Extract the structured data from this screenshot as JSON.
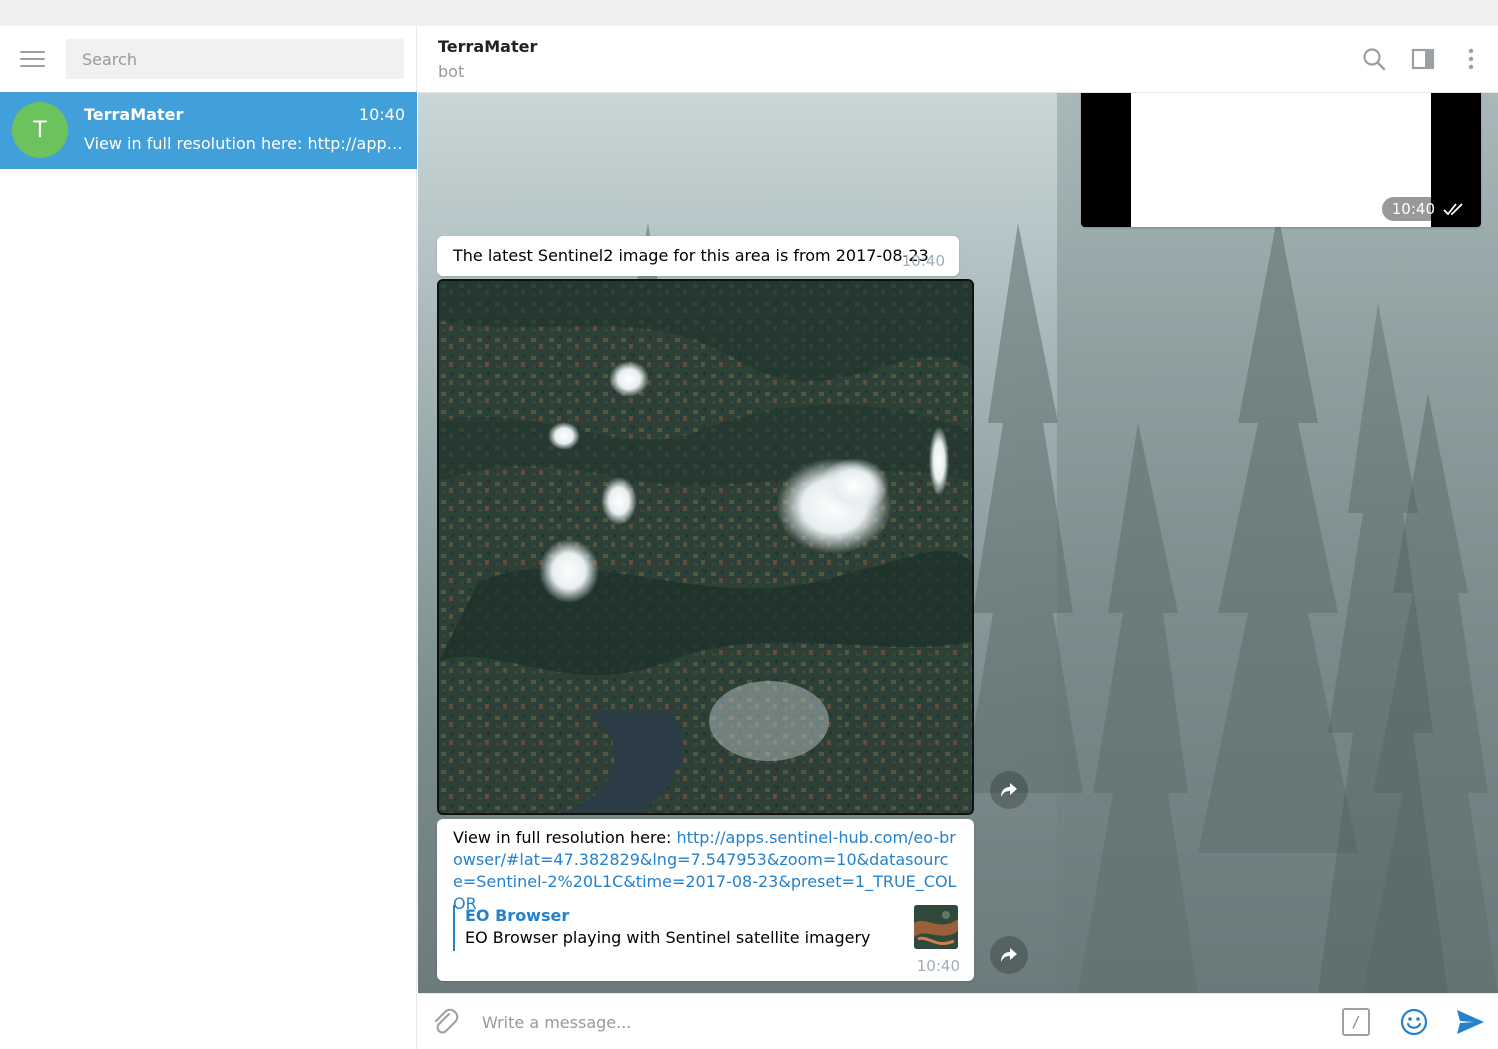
{
  "sidebar": {
    "search_placeholder": "Search",
    "dialogs": [
      {
        "avatar_letter": "T",
        "name": "TerraMater",
        "time": "10:40",
        "preview": "View in full resolution here: http://apps.sentinel-hub.com/eo-browser/#lat=47.382829&lng=7.547953&zoom=10&datasource=Sentinel-2%20L1C&time=2017-08-23&preset=1_TRUE_COLOR"
      }
    ]
  },
  "header": {
    "title": "TerraMater",
    "status": "bot",
    "icons": [
      "search-icon",
      "sidebar-toggle-icon",
      "more-vertical-icon"
    ]
  },
  "messages": {
    "top_photo": {
      "time": "10:40",
      "status_icon": "double-check-icon"
    },
    "text_1": {
      "text": "The latest Sentinel2 image for this area is from 2017-08-23",
      "time": "10:40"
    },
    "satellite_photo": {
      "description_icon": "satellite-image"
    },
    "link_message": {
      "prefix": "View in full resolution here: ",
      "link": "http://apps.sentinel-hub.com/eo-browser/#lat=47.382829&lng=7.547953&zoom=10&datasource=Sentinel-2%20L1C&time=2017-08-23&preset=1_TRUE_COLOR",
      "preview_site": "EO Browser",
      "preview_description": "EO Browser playing with Sentinel satellite imagery",
      "time": "10:40"
    }
  },
  "composer": {
    "placeholder": "Write a message...",
    "command_symbol": "/"
  },
  "colors": {
    "accent": "#419fd9",
    "link": "#2481cc",
    "avatar": "#6cc35e"
  }
}
